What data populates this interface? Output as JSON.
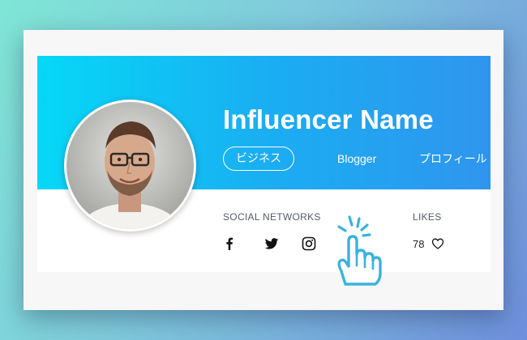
{
  "profile": {
    "name": "Influencer Name",
    "tags": [
      "ビジネス",
      "Blogger",
      "プロフィール"
    ],
    "social_label": "SOCIAL NETWORKS",
    "likes_label": "LIKES",
    "likes_count": "78"
  },
  "icons": {
    "social": [
      "facebook-icon",
      "twitter-icon",
      "instagram-icon"
    ],
    "likes": "heart-icon",
    "pointer": "hand-pointer-icon"
  },
  "colors": {
    "banner_start": "#06d8f6",
    "banner_end": "#2f95ee",
    "cursor": "#3ab3dc"
  }
}
